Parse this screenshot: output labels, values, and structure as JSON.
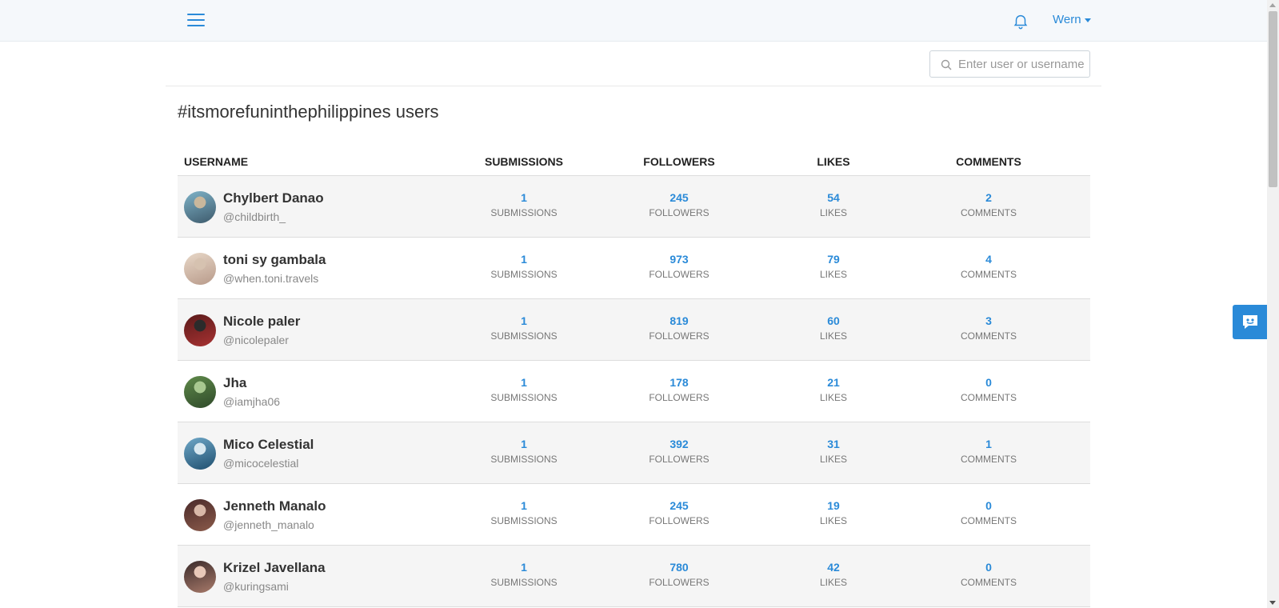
{
  "header": {
    "menu_icon": "hamburger-menu-icon",
    "notification_icon": "bell-icon",
    "user_name": "Wern"
  },
  "search": {
    "placeholder": "Enter user or username",
    "icon": "search-icon"
  },
  "page": {
    "title": "#itsmorefuninthephilippines users"
  },
  "table": {
    "columns": [
      "USERNAME",
      "SUBMISSIONS",
      "FOLLOWERS",
      "LIKES",
      "COMMENTS"
    ],
    "stat_labels": {
      "submissions": "SUBMISSIONS",
      "followers": "FOLLOWERS",
      "likes": "LIKES",
      "comments": "COMMENTS"
    },
    "rows": [
      {
        "name": "Chylbert Danao",
        "handle": "@childbirth_",
        "submissions": "1",
        "followers": "245",
        "likes": "54",
        "comments": "2"
      },
      {
        "name": "toni sy gambala",
        "handle": "@when.toni.travels",
        "submissions": "1",
        "followers": "973",
        "likes": "79",
        "comments": "4"
      },
      {
        "name": "Nicole paler",
        "handle": "@nicolepaler",
        "submissions": "1",
        "followers": "819",
        "likes": "60",
        "comments": "3"
      },
      {
        "name": "Jha",
        "handle": "@iamjha06",
        "submissions": "1",
        "followers": "178",
        "likes": "21",
        "comments": "0"
      },
      {
        "name": "Mico Celestial",
        "handle": "@micocelestial",
        "submissions": "1",
        "followers": "392",
        "likes": "31",
        "comments": "1"
      },
      {
        "name": "Jenneth Manalo",
        "handle": "@jenneth_manalo",
        "submissions": "1",
        "followers": "245",
        "likes": "19",
        "comments": "0"
      },
      {
        "name": "Krizel Javellana",
        "handle": "@kuringsami",
        "submissions": "1",
        "followers": "780",
        "likes": "42",
        "comments": "0"
      }
    ]
  },
  "chat": {
    "icon": "chat-bot-icon"
  },
  "colors": {
    "accent": "#2a8ad8",
    "topbar_bg": "#f5f8fb",
    "row_alt_bg": "#f5f5f5"
  }
}
